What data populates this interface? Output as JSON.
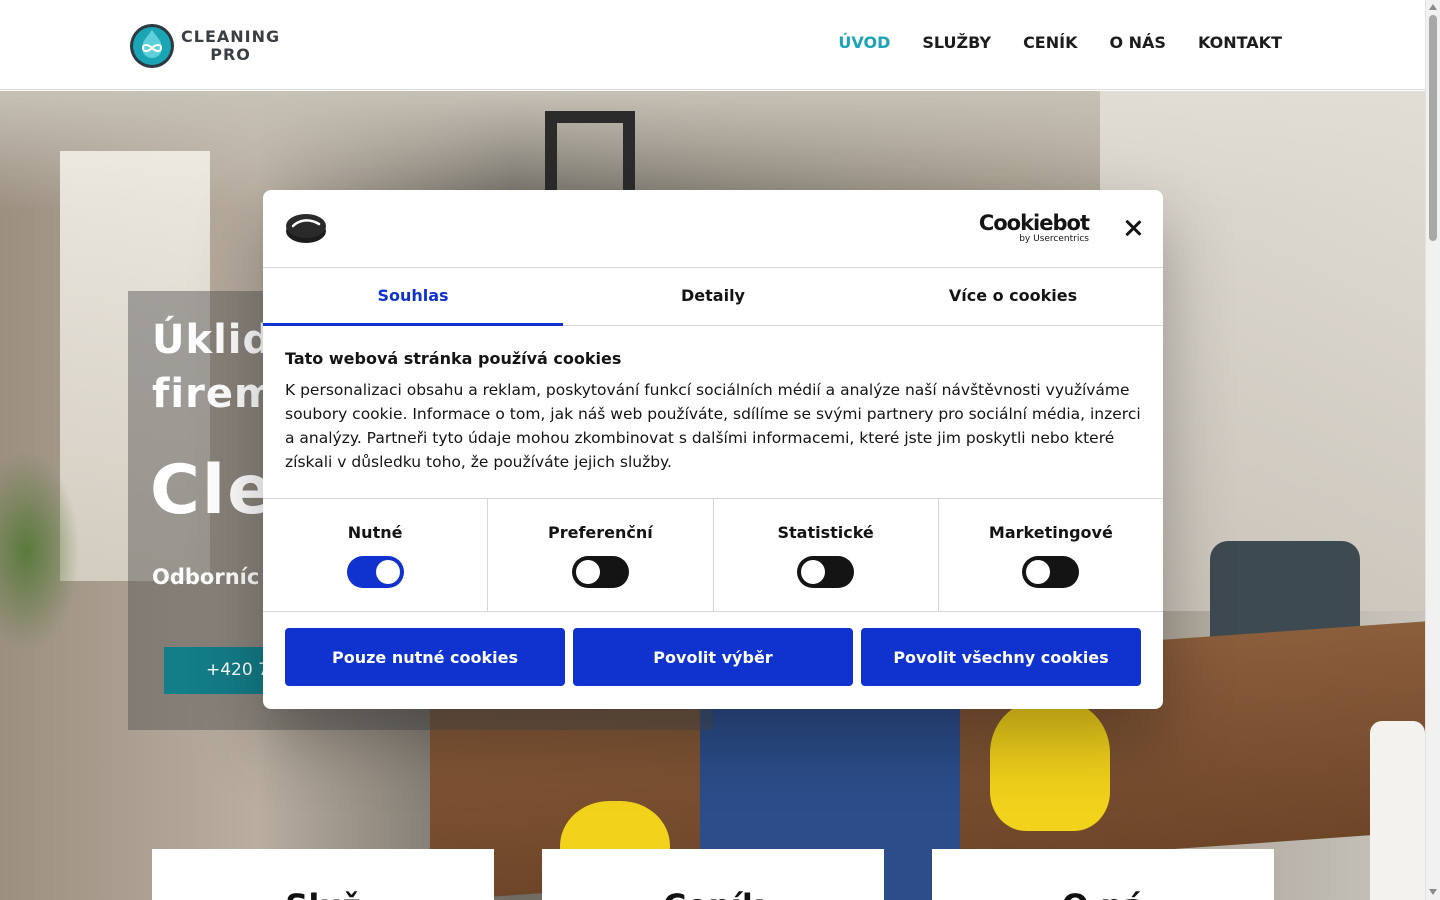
{
  "header": {
    "logo": {
      "line1": "CLEANING",
      "line2": "PRO"
    },
    "nav": [
      {
        "label": "ÚVOD",
        "active": true
      },
      {
        "label": "SLUŽBY",
        "active": false
      },
      {
        "label": "CENÍK",
        "active": false
      },
      {
        "label": "O NÁS",
        "active": false
      },
      {
        "label": "KONTAKT",
        "active": false
      }
    ]
  },
  "hero": {
    "title_visible": "Úklid\nfirem",
    "brand_visible": "Cle",
    "subtitle_visible": "Odborníc",
    "phone_visible": "+420 7",
    "cards_visible": [
      "Služ",
      "Ceník",
      "O ná"
    ]
  },
  "cookie_dialog": {
    "brand": {
      "main": "Cookiebot",
      "sub": "by Usercentrics"
    },
    "tabs": [
      {
        "label": "Souhlas",
        "active": true
      },
      {
        "label": "Detaily",
        "active": false
      },
      {
        "label": "Více o cookies",
        "active": false
      }
    ],
    "heading": "Tato webová stránka používá cookies",
    "body": "K personalizaci obsahu a reklam, poskytování funkcí sociálních médií a analýze naší návštěvnosti využíváme soubory cookie. Informace o tom, jak náš web používáte, sdílíme se svými partnery pro sociální média, inzerci a analýzy. Partneři tyto údaje mohou zkombinovat s dalšími informacemi, které jste jim poskytli nebo které získali v důsledku toho, že používáte jejich služby.",
    "toggles": [
      {
        "label": "Nutné",
        "on": true
      },
      {
        "label": "Preferenční",
        "on": false
      },
      {
        "label": "Statistické",
        "on": false
      },
      {
        "label": "Marketingové",
        "on": false
      }
    ],
    "buttons": [
      {
        "label": "Pouze nutné cookies"
      },
      {
        "label": "Povolit výběr"
      },
      {
        "label": "Povolit všechny cookies"
      }
    ]
  },
  "colors": {
    "brand_accent": "#1ba4b4",
    "cookiebot_blue": "#1032cf",
    "phone_button": "#137d88"
  }
}
